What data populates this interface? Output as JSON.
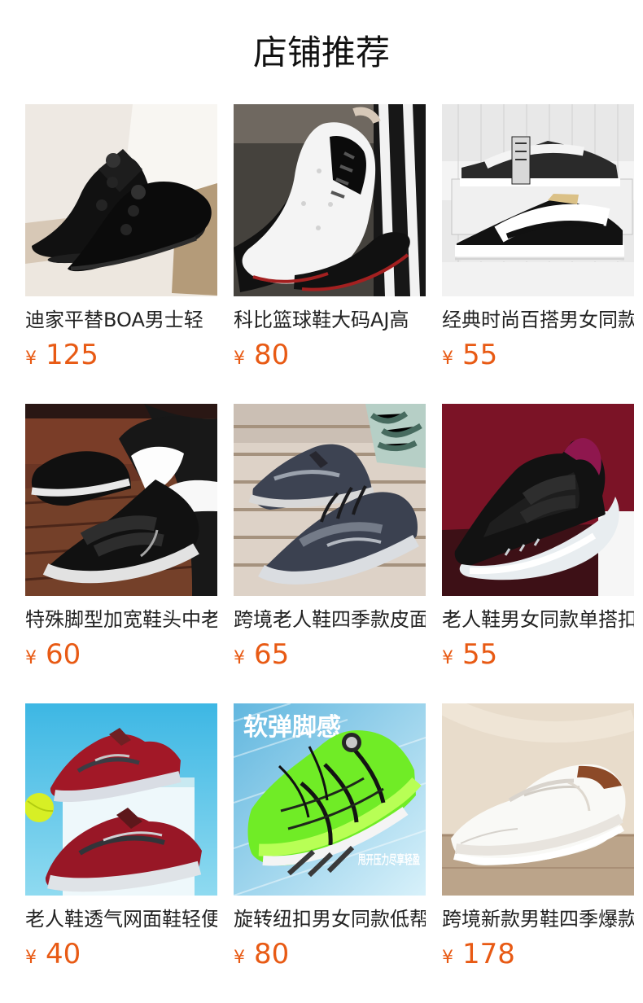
{
  "page_title": "店铺推荐",
  "currency_symbol": "¥",
  "accent_color": "#e85a14",
  "products": [
    {
      "name": "迪家平替BOA男士轻",
      "price": "125",
      "image": "black-boa-sneakers"
    },
    {
      "name": "科比篮球鞋大码AJ高",
      "price": "80",
      "image": "white-black-basketball-shoes"
    },
    {
      "name": "经典时尚百搭男女同款",
      "price": "55",
      "image": "black-white-suede-sneakers"
    },
    {
      "name": "特殊脚型加宽鞋头中老",
      "price": "60",
      "image": "black-velcro-walking-shoes"
    },
    {
      "name": "跨境老人鞋四季款皮面",
      "price": "65",
      "image": "gray-leather-lace-shoes"
    },
    {
      "name": "老人鞋男女同款单搭扣",
      "price": "55",
      "image": "black-purple-velcro-shoe"
    },
    {
      "name": "老人鞋透气网面鞋轻便",
      "price": "40",
      "image": "red-mesh-walking-shoes"
    },
    {
      "name": "旋转纽扣男女同款低帮",
      "price": "80",
      "image": "green-running-shoe",
      "image_text_top": "软弹脚感",
      "image_text_bottom": "甩开压力尽享轻盈"
    },
    {
      "name": "跨境新款男鞋四季爆款",
      "price": "178",
      "image": "white-leather-slip-on"
    }
  ]
}
